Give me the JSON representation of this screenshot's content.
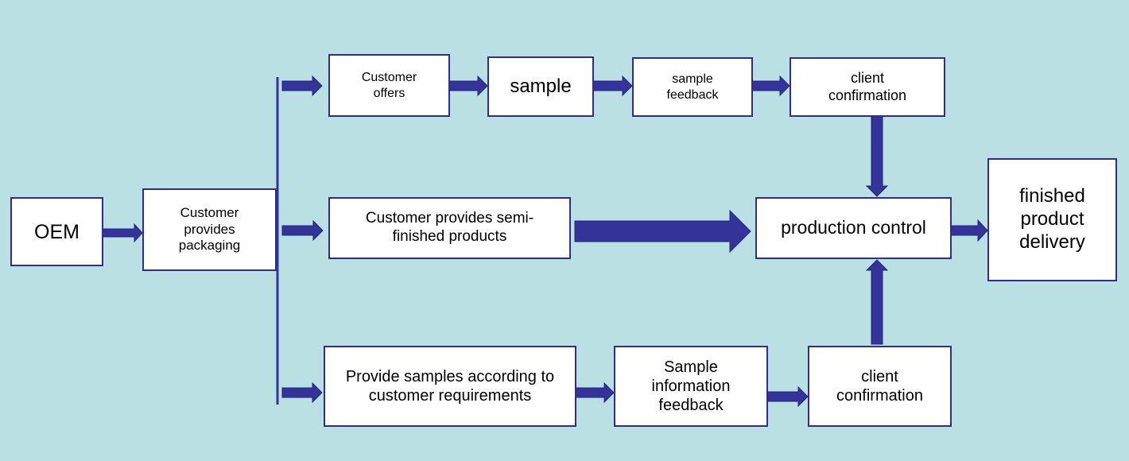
{
  "colors": {
    "background": "#bae0e3",
    "arrow": "#333399",
    "box_border": "#2e2e8f"
  },
  "nodes": {
    "oem": "OEM",
    "packaging": "Customer provides packaging",
    "customer_offers": "Customer offers",
    "sample": "sample",
    "sample_feedback": "sample feedback",
    "client_confirmation_top": "client confirmation",
    "semi_finished": "Customer provides semi-finished products",
    "production_control": "production control",
    "delivery": "finished product delivery",
    "provide_samples": "Provide samples according to customer requirements",
    "sample_info_feedback": "Sample information feedback",
    "client_confirmation_bottom": "client confirmation"
  }
}
